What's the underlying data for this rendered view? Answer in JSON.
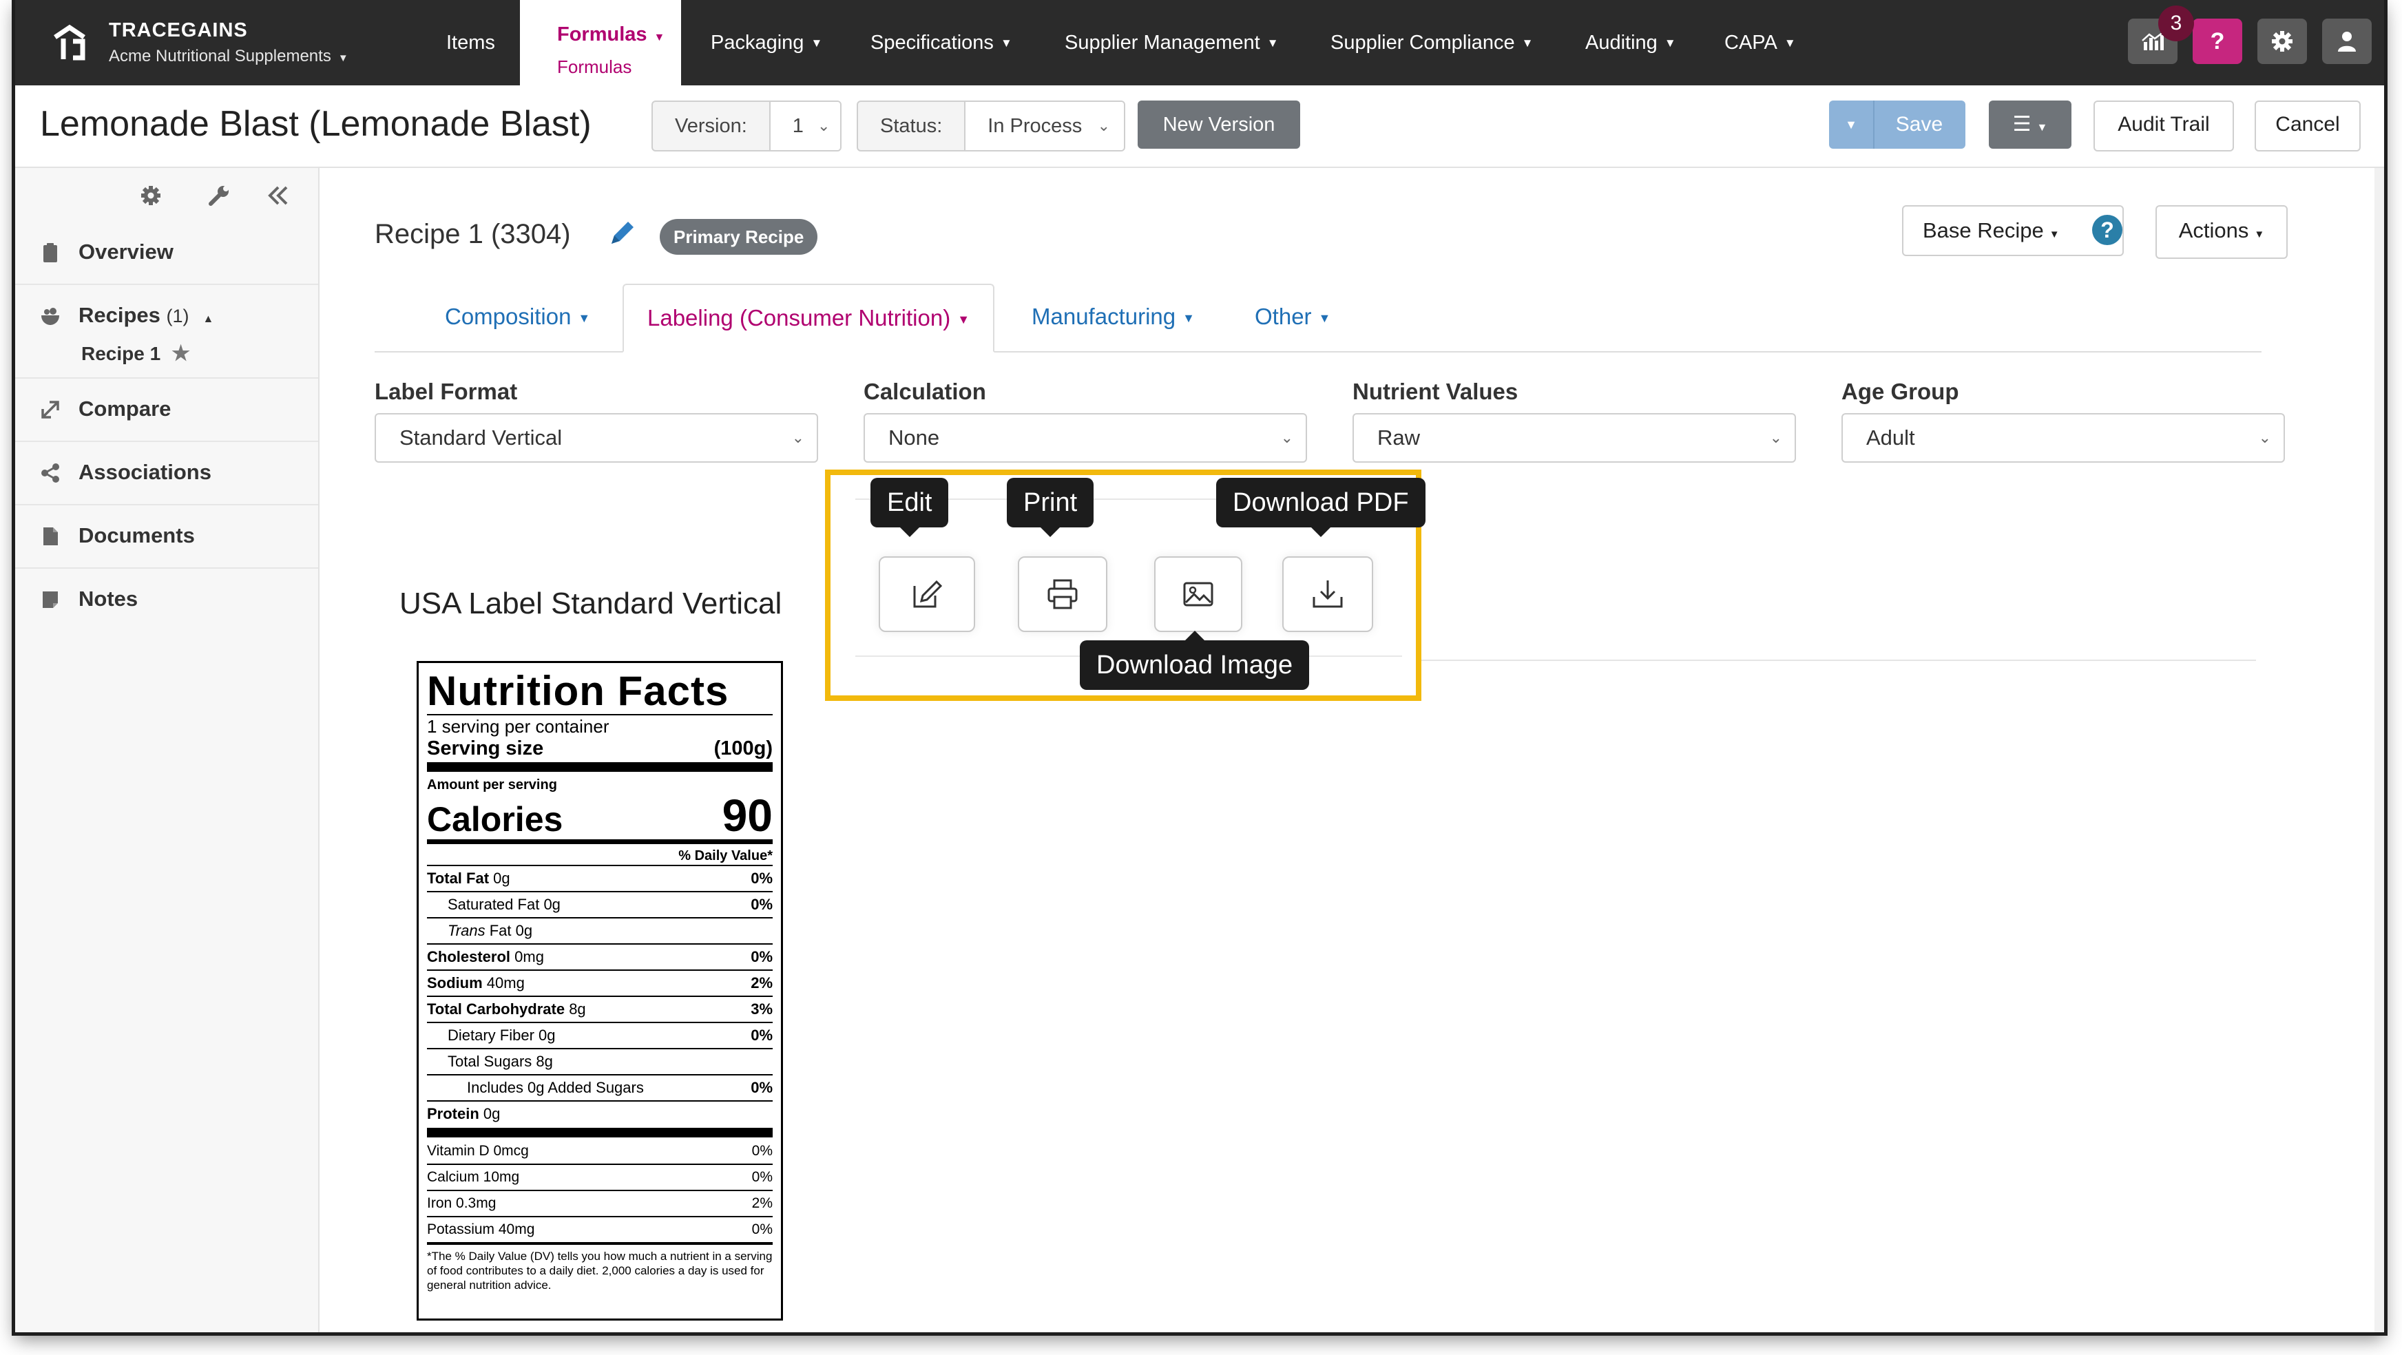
{
  "navbar": {
    "brand": "TRACEGAINS",
    "org": "Acme Nutritional Supplements",
    "items": [
      "Items",
      "Packaging",
      "Specifications",
      "Supplier Management",
      "Supplier Compliance",
      "Auditing",
      "CAPA"
    ],
    "active": {
      "label": "Formulas",
      "sub": "Formulas"
    },
    "help_badge": "3",
    "help_label": "?",
    "icons": [
      "analytics-icon",
      "help-icon",
      "gear-icon",
      "user-icon"
    ]
  },
  "header": {
    "title": "Lemonade Blast (Lemonade Blast)",
    "version_label": "Version:",
    "version_value": "1",
    "status_label": "Status:",
    "status_value": "In Process",
    "new_version": "New Version",
    "save": "Save",
    "audit_trail": "Audit Trail",
    "cancel": "Cancel"
  },
  "sidebar": {
    "items": [
      {
        "label": "Overview",
        "icon": "clipboard-icon"
      },
      {
        "label": "Recipes",
        "count": "(1)",
        "icon": "bowl-icon"
      },
      {
        "label": "Compare",
        "icon": "compare-icon"
      },
      {
        "label": "Associations",
        "icon": "share-icon"
      },
      {
        "label": "Documents",
        "icon": "document-icon"
      },
      {
        "label": "Notes",
        "icon": "note-icon"
      }
    ],
    "sub_recipe": "Recipe 1"
  },
  "main": {
    "recipe_title": "Recipe 1 (3304)",
    "primary_badge": "Primary Recipe",
    "base_recipe": "Base Recipe",
    "actions": "Actions",
    "tabs": [
      "Composition",
      "Labeling (Consumer Nutrition)",
      "Manufacturing",
      "Other"
    ],
    "fields": [
      {
        "label": "Label Format",
        "value": "Standard Vertical"
      },
      {
        "label": "Calculation",
        "value": "None"
      },
      {
        "label": "Nutrient Values",
        "value": "Raw"
      },
      {
        "label": "Age Group",
        "value": "Adult"
      }
    ],
    "label_heading": "USA Label Standard Vertical",
    "tooltips": {
      "edit": "Edit",
      "print": "Print",
      "download_pdf": "Download PDF",
      "download_image": "Download Image"
    }
  },
  "nutrition": {
    "title": "Nutrition Facts",
    "servings": "1 serving per container",
    "serving_size_label": "Serving size",
    "serving_size_value": "(100g)",
    "amount_per_serving": "Amount per serving",
    "calories_label": "Calories",
    "calories_value": "90",
    "dv_header": "% Daily Value*",
    "rows": [
      {
        "name": "Total Fat",
        "amt": "0g",
        "dv": "0%"
      },
      {
        "name": "Saturated Fat",
        "amt": "0g",
        "dv": "0%"
      },
      {
        "name": "Trans",
        "amt": "Fat 0g",
        "dv": ""
      },
      {
        "name": "Cholesterol",
        "amt": "0mg",
        "dv": "0%"
      },
      {
        "name": "Sodium",
        "amt": "40mg",
        "dv": "2%"
      },
      {
        "name": "Total Carbohydrate",
        "amt": "8g",
        "dv": "3%"
      },
      {
        "name": "Dietary Fiber",
        "amt": "0g",
        "dv": "0%"
      },
      {
        "name": "Total Sugars",
        "amt": "8g",
        "dv": ""
      },
      {
        "name": "Includes 0g Added Sugars",
        "amt": "",
        "dv": "0%"
      },
      {
        "name": "Protein",
        "amt": "0g",
        "dv": ""
      }
    ],
    "vitamins": [
      {
        "name": "Vitamin D 0mcg",
        "dv": "0%"
      },
      {
        "name": "Calcium 10mg",
        "dv": "0%"
      },
      {
        "name": "Iron 0.3mg",
        "dv": "2%"
      },
      {
        "name": "Potassium 40mg",
        "dv": "0%"
      }
    ],
    "footnote": "*The % Daily Value (DV) tells you how much a nutrient in a serving of food contributes to a daily diet. 2,000 calories a day is used for general nutrition advice."
  },
  "colors": {
    "accent": "#b0006f",
    "link": "#1f6fb5",
    "highlight": "#f2b90d",
    "navbar": "#2b2b2b"
  }
}
